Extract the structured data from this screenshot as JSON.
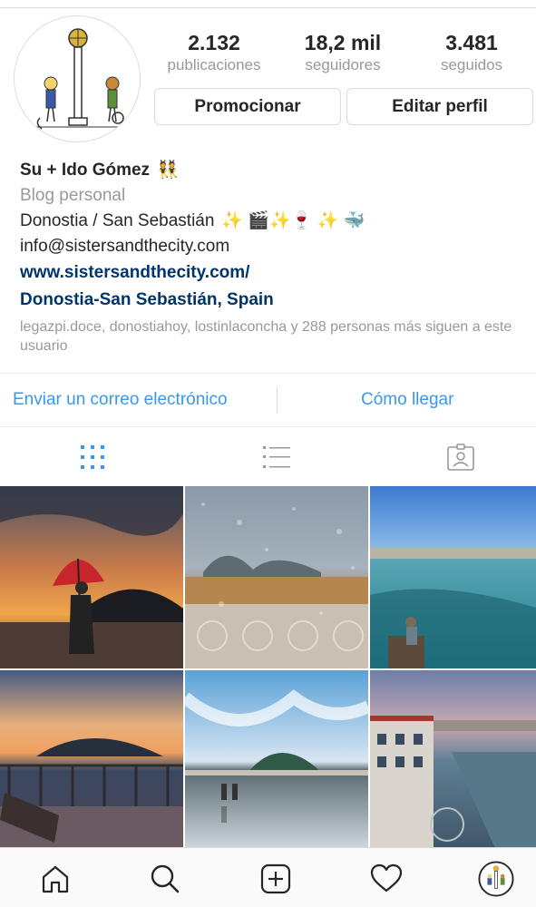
{
  "profile": {
    "stats": [
      {
        "value": "2.132",
        "label": "publicaciones"
      },
      {
        "value": "18,2 mil",
        "label": "seguidores"
      },
      {
        "value": "3.481",
        "label": "seguidos"
      }
    ],
    "promote_label": "Promocionar",
    "edit_label": "Editar perfil",
    "name": "Su + Ido Gómez",
    "name_emoji": "👯",
    "category": "Blog personal",
    "location_line": "Donostia / San Sebastián",
    "location_emojis": "✨ 🎬✨🍷 ✨ 🐳",
    "email": "info@sistersandthecity.com",
    "website": "www.sistersandthecity.com/",
    "place": "Donostia-San Sebastián, Spain",
    "followed_by": "legazpi.doce, donostiahoy, lostinlaconcha y 288 personas más siguen a este usuario"
  },
  "actions": {
    "email_label": "Enviar un correo electrónico",
    "directions_label": "Cómo llegar"
  },
  "colors": {
    "accent": "#3897f0",
    "link": "#003569",
    "muted": "#999999"
  },
  "tabs": [
    {
      "name": "grid-view-icon",
      "active": true
    },
    {
      "name": "list-view-icon",
      "active": false
    },
    {
      "name": "tagged-icon",
      "active": false
    }
  ],
  "bottom_nav": [
    "home-icon",
    "search-icon",
    "add-post-icon",
    "activity-heart-icon",
    "profile-avatar-icon"
  ]
}
